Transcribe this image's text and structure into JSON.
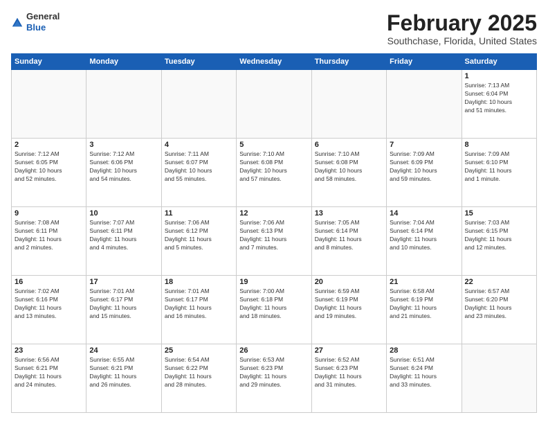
{
  "header": {
    "logo": {
      "general": "General",
      "blue": "Blue"
    },
    "title": "February 2025",
    "location": "Southchase, Florida, United States"
  },
  "calendar": {
    "days_of_week": [
      "Sunday",
      "Monday",
      "Tuesday",
      "Wednesday",
      "Thursday",
      "Friday",
      "Saturday"
    ],
    "weeks": [
      [
        {
          "day": "",
          "content": ""
        },
        {
          "day": "",
          "content": ""
        },
        {
          "day": "",
          "content": ""
        },
        {
          "day": "",
          "content": ""
        },
        {
          "day": "",
          "content": ""
        },
        {
          "day": "",
          "content": ""
        },
        {
          "day": "1",
          "content": "Sunrise: 7:13 AM\nSunset: 6:04 PM\nDaylight: 10 hours\nand 51 minutes."
        }
      ],
      [
        {
          "day": "2",
          "content": "Sunrise: 7:12 AM\nSunset: 6:05 PM\nDaylight: 10 hours\nand 52 minutes."
        },
        {
          "day": "3",
          "content": "Sunrise: 7:12 AM\nSunset: 6:06 PM\nDaylight: 10 hours\nand 54 minutes."
        },
        {
          "day": "4",
          "content": "Sunrise: 7:11 AM\nSunset: 6:07 PM\nDaylight: 10 hours\nand 55 minutes."
        },
        {
          "day": "5",
          "content": "Sunrise: 7:10 AM\nSunset: 6:08 PM\nDaylight: 10 hours\nand 57 minutes."
        },
        {
          "day": "6",
          "content": "Sunrise: 7:10 AM\nSunset: 6:08 PM\nDaylight: 10 hours\nand 58 minutes."
        },
        {
          "day": "7",
          "content": "Sunrise: 7:09 AM\nSunset: 6:09 PM\nDaylight: 10 hours\nand 59 minutes."
        },
        {
          "day": "8",
          "content": "Sunrise: 7:09 AM\nSunset: 6:10 PM\nDaylight: 11 hours\nand 1 minute."
        }
      ],
      [
        {
          "day": "9",
          "content": "Sunrise: 7:08 AM\nSunset: 6:11 PM\nDaylight: 11 hours\nand 2 minutes."
        },
        {
          "day": "10",
          "content": "Sunrise: 7:07 AM\nSunset: 6:11 PM\nDaylight: 11 hours\nand 4 minutes."
        },
        {
          "day": "11",
          "content": "Sunrise: 7:06 AM\nSunset: 6:12 PM\nDaylight: 11 hours\nand 5 minutes."
        },
        {
          "day": "12",
          "content": "Sunrise: 7:06 AM\nSunset: 6:13 PM\nDaylight: 11 hours\nand 7 minutes."
        },
        {
          "day": "13",
          "content": "Sunrise: 7:05 AM\nSunset: 6:14 PM\nDaylight: 11 hours\nand 8 minutes."
        },
        {
          "day": "14",
          "content": "Sunrise: 7:04 AM\nSunset: 6:14 PM\nDaylight: 11 hours\nand 10 minutes."
        },
        {
          "day": "15",
          "content": "Sunrise: 7:03 AM\nSunset: 6:15 PM\nDaylight: 11 hours\nand 12 minutes."
        }
      ],
      [
        {
          "day": "16",
          "content": "Sunrise: 7:02 AM\nSunset: 6:16 PM\nDaylight: 11 hours\nand 13 minutes."
        },
        {
          "day": "17",
          "content": "Sunrise: 7:01 AM\nSunset: 6:17 PM\nDaylight: 11 hours\nand 15 minutes."
        },
        {
          "day": "18",
          "content": "Sunrise: 7:01 AM\nSunset: 6:17 PM\nDaylight: 11 hours\nand 16 minutes."
        },
        {
          "day": "19",
          "content": "Sunrise: 7:00 AM\nSunset: 6:18 PM\nDaylight: 11 hours\nand 18 minutes."
        },
        {
          "day": "20",
          "content": "Sunrise: 6:59 AM\nSunset: 6:19 PM\nDaylight: 11 hours\nand 19 minutes."
        },
        {
          "day": "21",
          "content": "Sunrise: 6:58 AM\nSunset: 6:19 PM\nDaylight: 11 hours\nand 21 minutes."
        },
        {
          "day": "22",
          "content": "Sunrise: 6:57 AM\nSunset: 6:20 PM\nDaylight: 11 hours\nand 23 minutes."
        }
      ],
      [
        {
          "day": "23",
          "content": "Sunrise: 6:56 AM\nSunset: 6:21 PM\nDaylight: 11 hours\nand 24 minutes."
        },
        {
          "day": "24",
          "content": "Sunrise: 6:55 AM\nSunset: 6:21 PM\nDaylight: 11 hours\nand 26 minutes."
        },
        {
          "day": "25",
          "content": "Sunrise: 6:54 AM\nSunset: 6:22 PM\nDaylight: 11 hours\nand 28 minutes."
        },
        {
          "day": "26",
          "content": "Sunrise: 6:53 AM\nSunset: 6:23 PM\nDaylight: 11 hours\nand 29 minutes."
        },
        {
          "day": "27",
          "content": "Sunrise: 6:52 AM\nSunset: 6:23 PM\nDaylight: 11 hours\nand 31 minutes."
        },
        {
          "day": "28",
          "content": "Sunrise: 6:51 AM\nSunset: 6:24 PM\nDaylight: 11 hours\nand 33 minutes."
        },
        {
          "day": "",
          "content": ""
        }
      ]
    ]
  }
}
